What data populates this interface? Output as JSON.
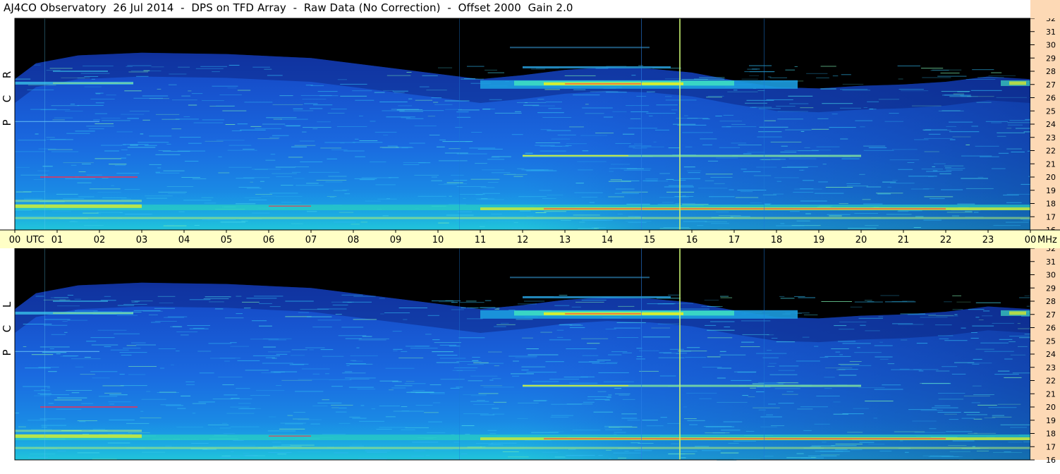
{
  "header": {
    "title": "AJ4CO Observatory  26 Jul 2014  -  DPS on TFD Array  -  Raw Data (No Correction)  -  Offset 2000  Gain 2.0"
  },
  "colors": {
    "axis_strip": "#fdd9b5",
    "time_strip": "#ffffc6",
    "background_sky": "#000000",
    "spectrum_base": "#1a4cd8",
    "spectrum_mid": "#17a8e6",
    "intense": "#e8f020",
    "peak": "#ff2a4a"
  },
  "chart_data": {
    "type": "heatmap",
    "x_axis": {
      "label_left": "00",
      "label_left_unit": "UTC",
      "ticks": [
        "01",
        "02",
        "03",
        "04",
        "05",
        "06",
        "07",
        "08",
        "09",
        "10",
        "11",
        "12",
        "13",
        "14",
        "15",
        "16",
        "17",
        "18",
        "19",
        "20",
        "21",
        "22",
        "23"
      ],
      "label_right": "00",
      "label_right_unit": "MHz",
      "range": [
        0,
        24
      ]
    },
    "y_axis": {
      "ticks": [
        "16",
        "17",
        "18",
        "19",
        "20",
        "21",
        "22",
        "23",
        "24",
        "25",
        "26",
        "27",
        "28",
        "29",
        "30",
        "31",
        "32"
      ],
      "range": [
        16,
        32
      ]
    },
    "panels": [
      {
        "name": "R C P",
        "letters": [
          "R",
          "C",
          "P"
        ]
      },
      {
        "name": "L C P",
        "letters": [
          "L",
          "C",
          "P"
        ]
      }
    ],
    "grid": false,
    "legend": "none"
  }
}
